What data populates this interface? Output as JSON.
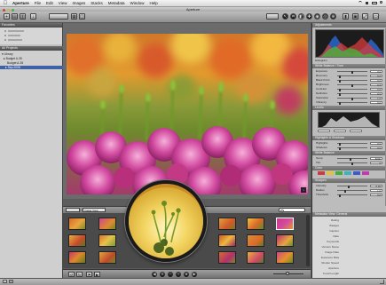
{
  "menubar": {
    "apple": "",
    "items": [
      "Aperture",
      "File",
      "Edit",
      "View",
      "Images",
      "Stacks",
      "Metadata",
      "Window",
      "Help"
    ]
  },
  "window": {
    "title": "Aperture"
  },
  "left_panel": {
    "header": "Favorites",
    "favorites": [
      "",
      "",
      ""
    ],
    "projects_header": "All Projects",
    "tree": [
      {
        "label": "▾ Library",
        "selected": false
      },
      {
        "label": "▸ Budget A-35",
        "selected": false
      },
      {
        "label": "  Budget A-35",
        "selected": false
      },
      {
        "label": "  ▸ Sep-2008",
        "selected": true
      }
    ]
  },
  "viewer": {
    "badge": ""
  },
  "filmstrip": {
    "view_label": "Image View",
    "search_label": ""
  },
  "inspector": {
    "tabs_label": "Adjustments",
    "histogram_label": "Histogram",
    "sections": [
      {
        "title": "White Balance / Tone"
      },
      {
        "title": "Levels"
      },
      {
        "title": "Highlights & Shadows"
      },
      {
        "title": "White Balance"
      },
      {
        "title": "Color"
      },
      {
        "title": "Sharpen"
      }
    ],
    "sliders": [
      {
        "label": "Exposure",
        "value": "0.0"
      },
      {
        "label": "Recovery",
        "value": "0.0"
      },
      {
        "label": "Black Point",
        "value": "0.0"
      },
      {
        "label": "Brightness",
        "value": "0.0"
      },
      {
        "label": "Contrast",
        "value": "0.0"
      },
      {
        "label": "Definition",
        "value": "0.0"
      },
      {
        "label": "Saturation",
        "value": "1.0"
      },
      {
        "label": "Vibrancy",
        "value": "0.0"
      },
      {
        "label": "Highlights",
        "value": "0.0"
      },
      {
        "label": "Shadows",
        "value": "0.0"
      },
      {
        "label": "Temp",
        "value": "5000"
      },
      {
        "label": "Tint",
        "value": "0"
      },
      {
        "label": "Intensity",
        "value": "0.40"
      },
      {
        "label": "Radius",
        "value": "1.0"
      },
      {
        "label": "Threshold",
        "value": "0.0"
      }
    ]
  },
  "metadata": {
    "header": "Metadata View: General",
    "rows": [
      {
        "k": "Rating",
        "v": ""
      },
      {
        "k": "Badges",
        "v": ""
      },
      {
        "k": "Caption",
        "v": ""
      },
      {
        "k": "Date",
        "v": ""
      },
      {
        "k": "Keywords",
        "v": ""
      },
      {
        "k": "Version Name",
        "v": ""
      },
      {
        "k": "Image Date",
        "v": ""
      },
      {
        "k": "Exposure Bias",
        "v": ""
      },
      {
        "k": "Shutter Speed",
        "v": ""
      },
      {
        "k": "Aperture",
        "v": ""
      },
      {
        "k": "Focal Length",
        "v": ""
      }
    ]
  },
  "colors": {
    "selection": "#3f62a6",
    "panel_gray": "#bcbcbc",
    "viewer_bg": "#6b6b6b"
  }
}
